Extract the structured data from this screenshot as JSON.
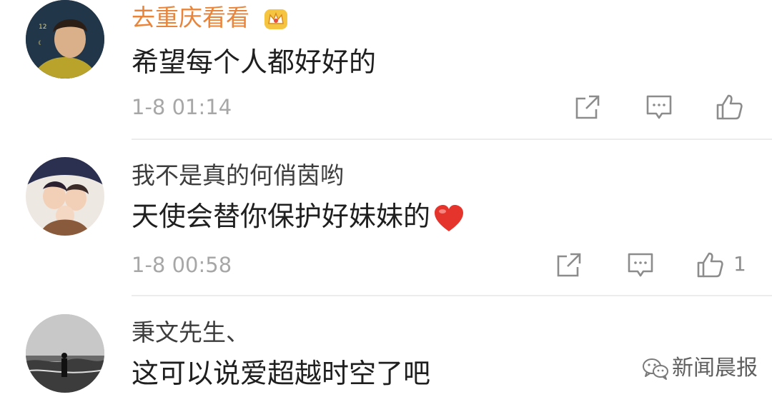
{
  "comments": [
    {
      "username": "去重庆看看",
      "username_color": "#e8853a",
      "badge_icon": "crown-icon",
      "content": "希望每个人都好好的",
      "time": "1-8 01:14",
      "like_count": ""
    },
    {
      "username": "我不是真的何俏茵哟",
      "username_color": "#3d3d3d",
      "content": "天使会替你保护好妹妹的",
      "emoji_icon": "red-heart-icon",
      "time": "1-8 00:58",
      "like_count": "1"
    },
    {
      "username": "秉文先生、",
      "username_color": "#3d3d3d",
      "content": "这可以说爱超越时空了吧"
    }
  ],
  "watermark": {
    "icon": "wechat-icon",
    "text": "新闻晨报"
  },
  "colors": {
    "time_text": "#a7a7a7",
    "icon_stroke": "#8c8c8c",
    "divider": "#ececec"
  }
}
